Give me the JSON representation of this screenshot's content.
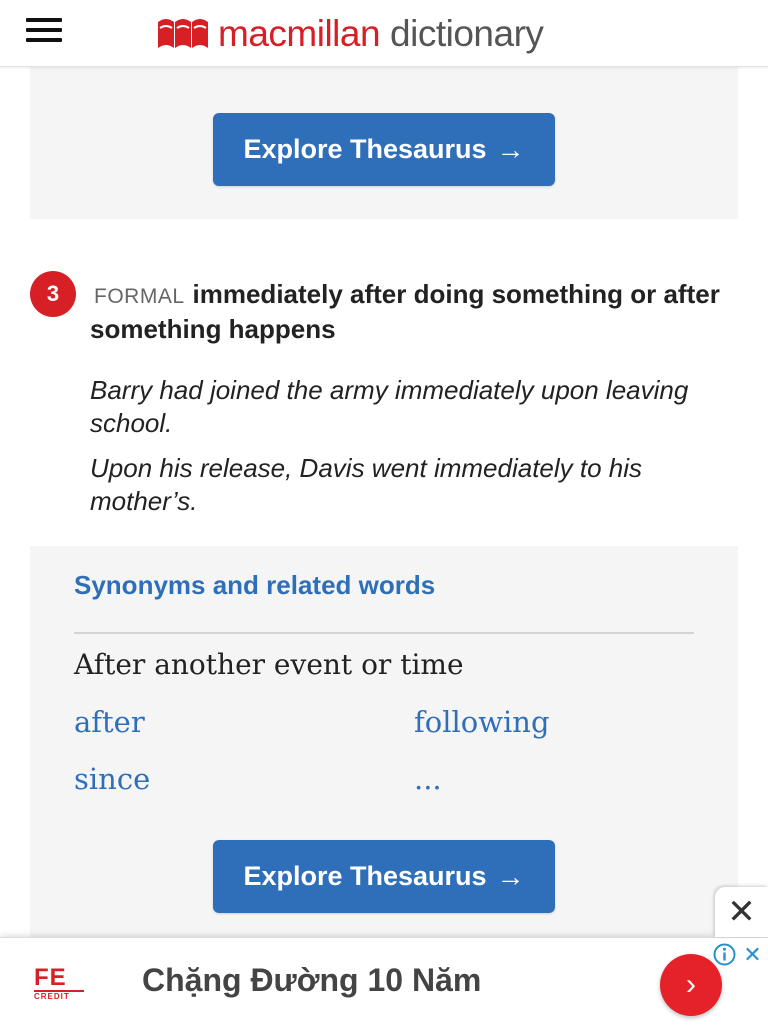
{
  "header": {
    "logo_word1": "macmillan",
    "logo_word2": "dictionary",
    "menu_icon": "hamburger-menu-icon"
  },
  "thesaurus_button_label": "Explore Thesaurus",
  "sense": {
    "number": "3",
    "register": "FORMAL",
    "definition": "immediately after doing something or after something happens",
    "examples": [
      "Barry had joined the army immediately upon leaving school.",
      "Upon his release, Davis went immediately to his mother’s."
    ]
  },
  "synonyms": {
    "title": "Synonyms and related words",
    "heading": "After another event or time",
    "words": [
      "after",
      "following",
      "since",
      "..."
    ]
  },
  "ad": {
    "logo_text": "FE",
    "logo_subtext": "CREDIT",
    "text": "Chặng Đường 10 Năm"
  },
  "colors": {
    "brand_red": "#d71f26",
    "link_blue": "#2f6fb9",
    "panel_grey": "#f5f5f5"
  }
}
